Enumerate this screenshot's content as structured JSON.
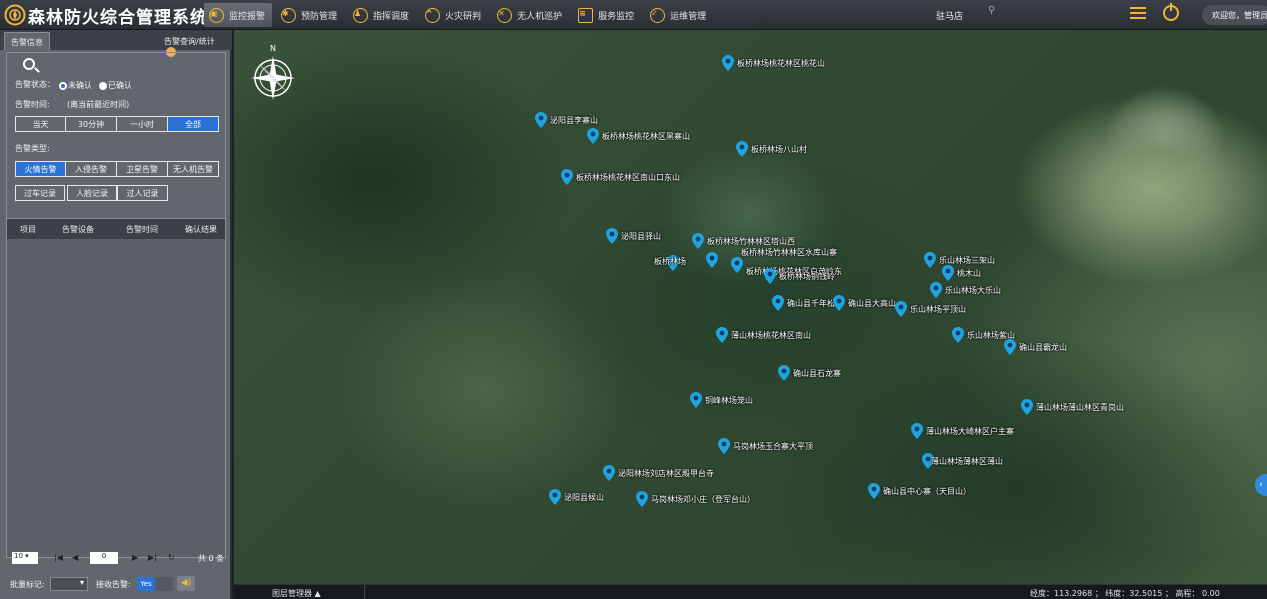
{
  "header": {
    "title": "森林防火综合管理系统",
    "nav": [
      {
        "label": "监控报警",
        "icon": "monitor-icon",
        "active": true
      },
      {
        "label": "预防管理",
        "icon": "prevention-icon",
        "active": false
      },
      {
        "label": "指挥调度",
        "icon": "command-icon",
        "active": false
      },
      {
        "label": "火灾研判",
        "icon": "fire-analysis-icon",
        "active": false
      },
      {
        "label": "无人机巡护",
        "icon": "drone-icon",
        "active": false
      },
      {
        "label": "服务监控",
        "icon": "service-icon",
        "active": false
      },
      {
        "label": "运维管理",
        "icon": "maintenance-icon",
        "active": false
      }
    ],
    "station": "驻马店",
    "welcome": "欢迎您，管理员"
  },
  "panel": {
    "tabs": [
      "告警信息",
      "告警查询/统计"
    ],
    "status_label": "告警状态：",
    "status_options": [
      "未确认",
      "已确认"
    ],
    "time_label": "告警时间:",
    "time_hint": "(离当前最近时间)",
    "time_options": [
      "当天",
      "30分钟",
      "一小时",
      "全部"
    ],
    "type_label": "告警类型:",
    "type_row1": [
      "火情告警",
      "入侵告警",
      "卫星告警",
      "无人机告警"
    ],
    "type_row2": [
      "过车记录",
      "人脸记录",
      "过人记录"
    ],
    "table_headers": [
      "项目",
      "告警设备",
      "告警时间",
      "确认结果"
    ],
    "page_size": "10",
    "page": "0",
    "total": "共 0 条",
    "batch_label": "批量标记:",
    "receive_label": "接收告警:",
    "receive_toggle": "Yes"
  },
  "map": {
    "accent": "#1fa4e0",
    "markers": [
      {
        "label": "板桥林场桃花林区桃花山"
      },
      {
        "label": "泌阳县李寨山"
      },
      {
        "label": "板桥林场桃花林区黑寨山"
      },
      {
        "label": "板桥林场八山村"
      },
      {
        "label": "板桥林场桃花林区南山口东山"
      },
      {
        "label": "泌阳县驿山"
      },
      {
        "label": "板桥林场竹林林区塔山西"
      },
      {
        "label": "板桥林场"
      },
      {
        "label": "板桥林场竹林林区水库山寨"
      },
      {
        "label": "板桥林场桃花林区白茂岭东"
      },
      {
        "label": "板桥林场铜钱岭"
      },
      {
        "label": "确山县千年松"
      },
      {
        "label": "确山县大高山"
      },
      {
        "label": "乐山林场平顶山"
      },
      {
        "label": "乐山林场三架山"
      },
      {
        "label": "桃木山"
      },
      {
        "label": "乐山林场大乐山"
      },
      {
        "label": "薄山林场桃花林区南山"
      },
      {
        "label": "乐山林场紫山"
      },
      {
        "label": "确山县霸龙山"
      },
      {
        "label": "确山县石龙寨"
      },
      {
        "label": "铜峰林场笼山"
      },
      {
        "label": "薄山林场薄山林区青岗山"
      },
      {
        "label": "薄山林场大崎林区户主寨"
      },
      {
        "label": "马岗林场玉合寨大平顶"
      },
      {
        "label": "薄山林场薄林区薄山"
      },
      {
        "label": "泌阳林场刘店林区殿甲台寺"
      },
      {
        "label": "确山县中心寨（天目山）"
      },
      {
        "label": "泌阳县候山"
      },
      {
        "label": "马岗林场邓小庄（登军台山）"
      }
    ]
  },
  "statusbar": {
    "layer_manager": "图层管理器 ▲",
    "coords": "经度：113.2968 ； 纬度：32.5015 ； 高程： 0.00"
  }
}
